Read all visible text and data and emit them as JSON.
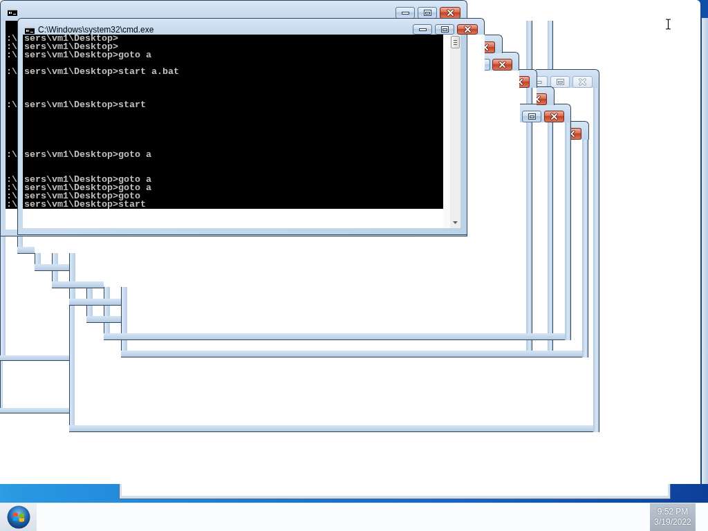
{
  "back_window": {
    "console_lines": [
      {
        "kind": "text",
        "text": ":\\"
      },
      {
        "kind": "text",
        "text": ":\\"
      },
      {
        "kind": "text",
        "text": ":\\"
      },
      {
        "kind": "blank"
      },
      {
        "kind": "text",
        "text": ":\\"
      },
      {
        "kind": "blank"
      },
      {
        "kind": "blank"
      },
      {
        "kind": "blank"
      },
      {
        "kind": "text",
        "text": ":\\"
      },
      {
        "kind": "blank"
      },
      {
        "kind": "blank"
      },
      {
        "kind": "blank"
      },
      {
        "kind": "blank"
      },
      {
        "kind": "blank"
      },
      {
        "kind": "text",
        "text": ":\\"
      },
      {
        "kind": "blank"
      },
      {
        "kind": "blank"
      },
      {
        "kind": "text",
        "text": ":\\"
      },
      {
        "kind": "text",
        "text": ":\\"
      },
      {
        "kind": "text",
        "text": ":\\"
      },
      {
        "kind": "text",
        "text": ":\\"
      }
    ]
  },
  "front_window": {
    "title": "C:\\Windows\\system32\\cmd.exe",
    "console_lines": [
      {
        "kind": "text",
        "text": "sers\\vm1\\Desktop>"
      },
      {
        "kind": "text",
        "text": "sers\\vm1\\Desktop>"
      },
      {
        "kind": "text",
        "text": "sers\\vm1\\Desktop>goto a"
      },
      {
        "kind": "blank"
      },
      {
        "kind": "text",
        "text": "sers\\vm1\\Desktop>start a.bat"
      },
      {
        "kind": "blank"
      },
      {
        "kind": "blank"
      },
      {
        "kind": "blank"
      },
      {
        "kind": "text",
        "text": "sers\\vm1\\Desktop>start"
      },
      {
        "kind": "blank"
      },
      {
        "kind": "blank"
      },
      {
        "kind": "blank"
      },
      {
        "kind": "blank"
      },
      {
        "kind": "blank"
      },
      {
        "kind": "text",
        "text": "sers\\vm1\\Desktop>goto a"
      },
      {
        "kind": "blank"
      },
      {
        "kind": "blank"
      },
      {
        "kind": "text",
        "text": "sers\\vm1\\Desktop>goto a"
      },
      {
        "kind": "text",
        "text": "sers\\vm1\\Desktop>goto a"
      },
      {
        "kind": "text",
        "text": "sers\\vm1\\Desktop>goto"
      },
      {
        "kind": "text",
        "text": "sers\\vm1\\Desktop>start"
      }
    ]
  },
  "taskbar": {
    "clock": {
      "time": "9:52 PM",
      "date": "3/19/2022"
    }
  }
}
